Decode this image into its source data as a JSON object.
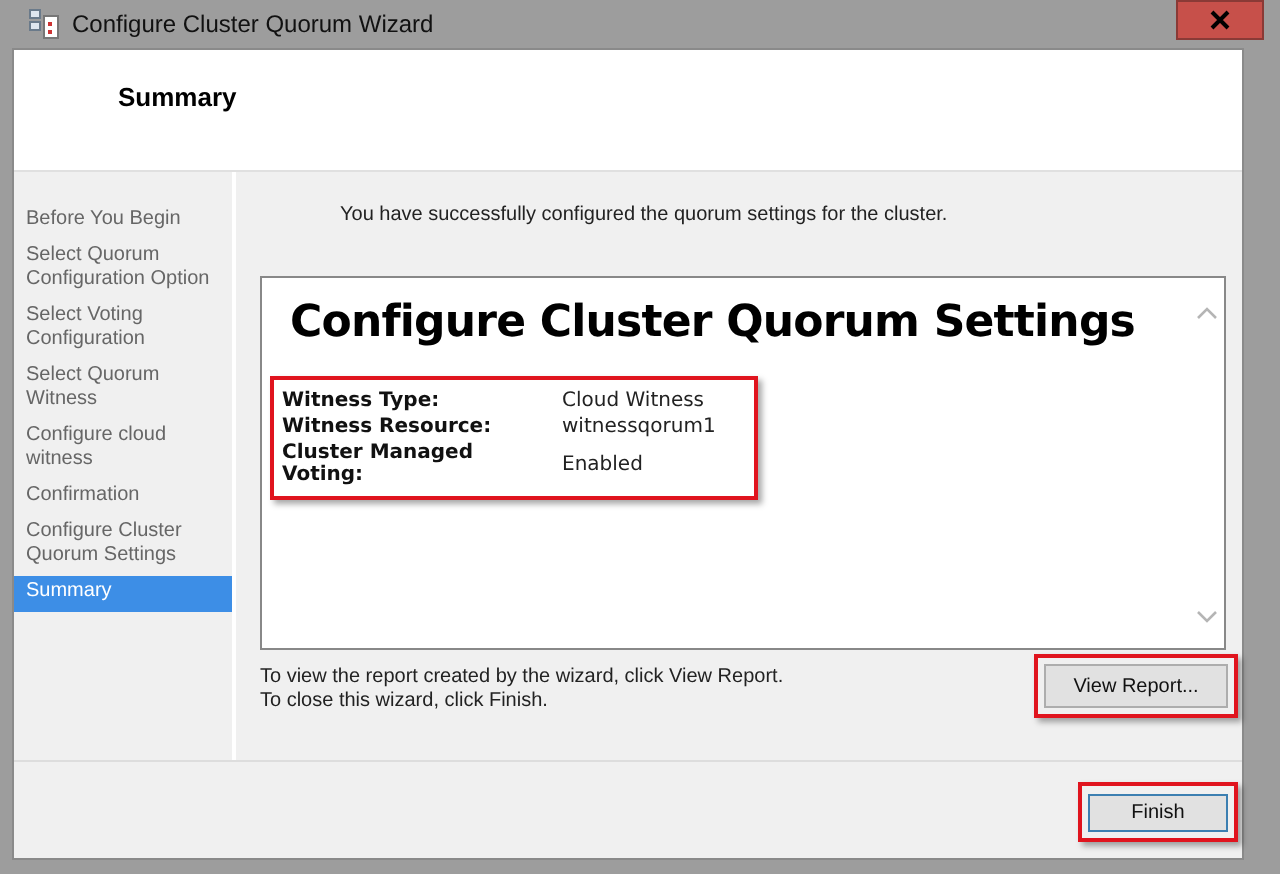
{
  "window": {
    "title": "Configure Cluster Quorum Wizard"
  },
  "header": {
    "title": "Summary"
  },
  "steps": [
    {
      "label": "Before You Begin",
      "selected": false
    },
    {
      "label": "Select Quorum Configuration Option",
      "selected": false
    },
    {
      "label": "Select Voting Configuration",
      "selected": false
    },
    {
      "label": "Select Quorum Witness",
      "selected": false
    },
    {
      "label": "Configure cloud witness",
      "selected": false
    },
    {
      "label": "Confirmation",
      "selected": false
    },
    {
      "label": "Configure Cluster Quorum Settings",
      "selected": false
    },
    {
      "label": "Summary",
      "selected": true
    }
  ],
  "message": "You have successfully configured the quorum settings for the cluster.",
  "report": {
    "title": "Configure Cluster Quorum Settings",
    "highlighted": true,
    "rows": [
      {
        "label": "Witness Type:",
        "value": "Cloud Witness"
      },
      {
        "label": "Witness Resource:",
        "value": "witnessqorum1"
      },
      {
        "label": "Cluster Managed Voting:",
        "value": "Enabled"
      }
    ]
  },
  "hints": [
    "To view the report created by the wizard, click View Report.",
    "To close this wizard, click Finish."
  ],
  "buttons": [
    {
      "label": "View Report...",
      "highlighted": true
    },
    {
      "label": "Finish",
      "highlighted": true
    }
  ]
}
